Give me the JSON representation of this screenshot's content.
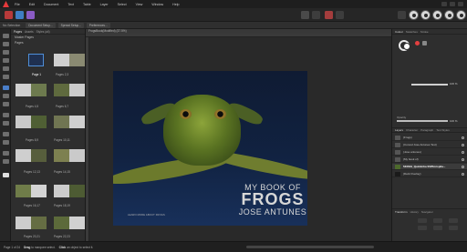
{
  "menu": {
    "items": [
      "File",
      "Edit",
      "Document",
      "Text",
      "Table",
      "Layer",
      "Select",
      "View",
      "Window",
      "Help"
    ]
  },
  "context": {
    "no_selection": "No Selection",
    "buttons": [
      "Document Setup...",
      "Spread Setup...",
      "Preferences..."
    ]
  },
  "pages_panel": {
    "tabs": [
      "Pages",
      "Assets",
      "Styles (all)"
    ],
    "master_section": "Master Pages",
    "pages_section": "Pages",
    "spreads": [
      {
        "label": "Page 1"
      },
      {
        "label": "Pages 2,3"
      },
      {
        "label": "Pages 4,5"
      },
      {
        "label": "Pages 6,7"
      },
      {
        "label": "Pages 8,9"
      },
      {
        "label": "Pages 10,11"
      },
      {
        "label": "Pages 12,13"
      },
      {
        "label": "Pages 14,15"
      },
      {
        "label": "Pages 16,17"
      },
      {
        "label": "Pages 18,19"
      },
      {
        "label": "Pages 20,21"
      },
      {
        "label": "Pages 22,23"
      }
    ]
  },
  "document": {
    "tab_title": "FrogsBook(Modified) (37.5%)"
  },
  "cover": {
    "line1": "MY BOOK OF",
    "line2": "FROGS",
    "line3": "JOSE ANTUNES",
    "small": "LEARN MORE ABOUT FROGS"
  },
  "right_panel": {
    "top_tabs": [
      "Colour",
      "Swatches",
      "Stroke"
    ],
    "hue_value": "100 %",
    "opacity_label": "Opacity",
    "opacity_value": "100 %",
    "layer_tabs": [
      "Layers",
      "Character",
      "Paragraph",
      "Text Styles"
    ],
    "layers": [
      {
        "name": "(Frogs)",
        "selected": false
      },
      {
        "name": "(Curved Jose Antunes Text)",
        "selected": false
      },
      {
        "name": "(Jose antunes)",
        "selected": false
      },
      {
        "name": "(My book of)",
        "selected": false
      },
      {
        "name": "540619_Quintinha 0025mrspila...",
        "selected": true
      },
      {
        "name": "(Dark Overlay)",
        "selected": false
      }
    ],
    "bottom_tabs": [
      "Transform",
      "History",
      "Navigator"
    ]
  },
  "status": {
    "left": "Page 1 of 24",
    "hint_drag": "Drag",
    "hint_drag_rest": "to marquee select.",
    "hint_click": "Click",
    "hint_click_rest": "an object to select it."
  },
  "colors": {
    "accent": "#e5393b",
    "background": "#2b2b2b",
    "cover_bg": "#112241"
  }
}
